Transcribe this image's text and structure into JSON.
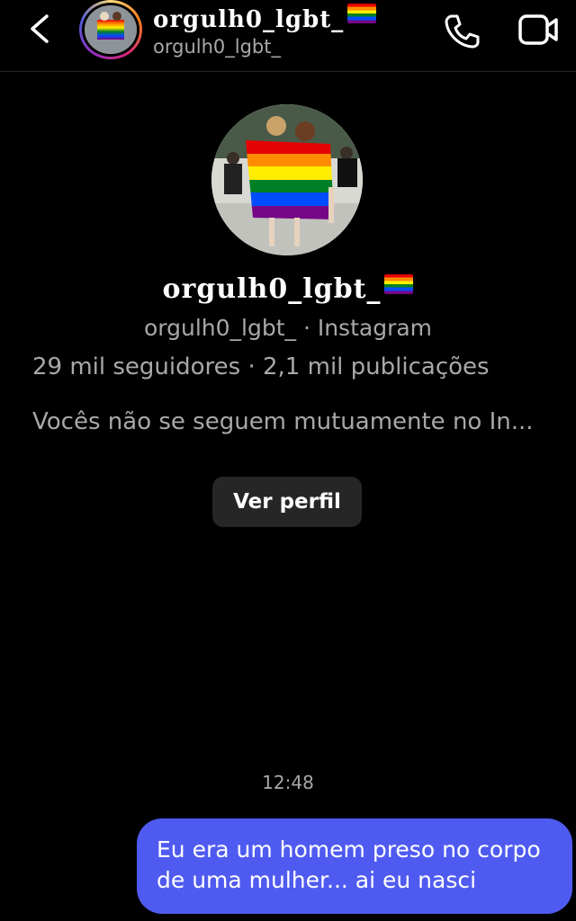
{
  "header": {
    "display_name": "orgulh0_lgbt_",
    "username": "orgulh0_lgbt_"
  },
  "profile": {
    "display_name": "orgulh0_lgbt_",
    "subtitle": "orgulh0_lgbt_ · Instagram",
    "stats": "29 mil seguidores · 2,1 mil publicações",
    "mutual_note": "Vocês não se seguem mutuamente no In...",
    "view_profile_label": "Ver perfil"
  },
  "chat": {
    "timestamp": "12:48",
    "messages": [
      {
        "text": "Eu era um homem preso no corpo de uma mulher... ai eu nasci",
        "sender": "me"
      }
    ]
  },
  "icons": {
    "back": "chevron-left-icon",
    "call": "phone-icon",
    "video": "video-camera-icon",
    "flag": "rainbow-flag-icon"
  },
  "colors": {
    "background": "#000000",
    "secondary_text": "#a8a8a8",
    "bubble": "#4f5bf0",
    "button": "#262626"
  }
}
